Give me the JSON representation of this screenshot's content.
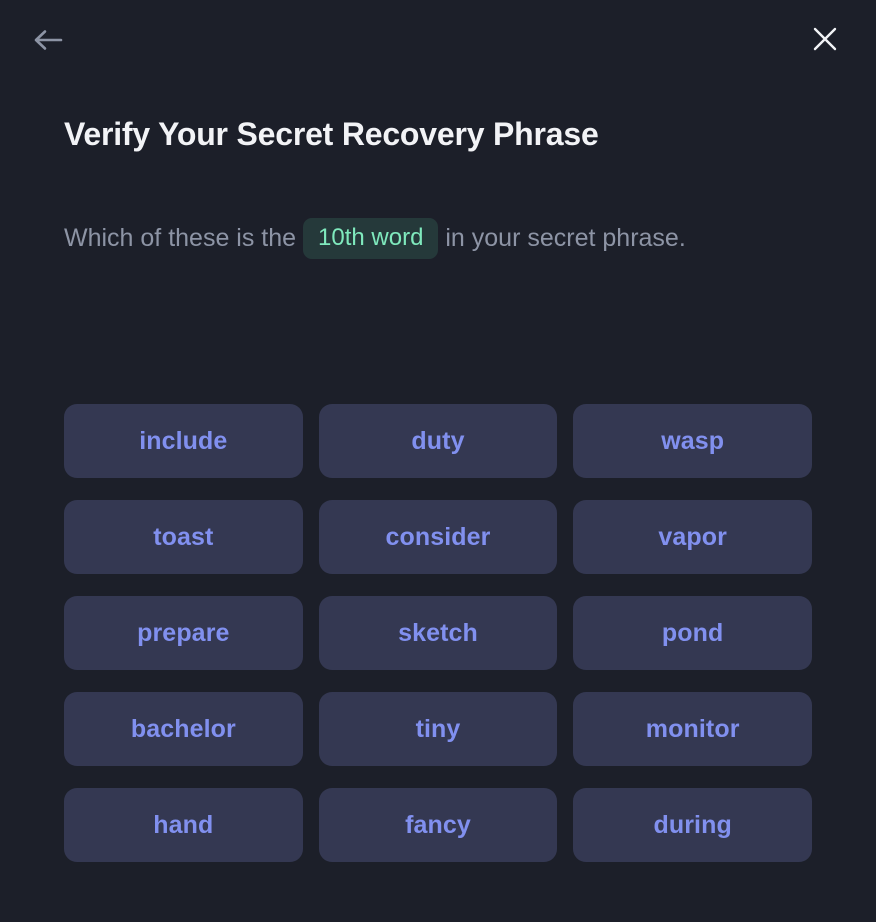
{
  "theme": {
    "background": "#1c1f29",
    "title_color": "#f2f3f6",
    "subtitle_color": "#8d94a5",
    "badge_background": "#25393a",
    "badge_text_color": "#7fe9bd",
    "option_background": "#343852",
    "option_text_color": "#8190ef",
    "back_icon_color": "#8d94a5",
    "close_icon_color": "#f2f3f6"
  },
  "topbar": {
    "back_icon": "arrow-left-icon",
    "back_label": "Back",
    "close_icon": "close-icon",
    "close_label": "Close"
  },
  "header": {
    "title": "Verify Your Secret Recovery Phrase"
  },
  "prompt": {
    "text_before": "Which of these is the",
    "badge": "10th word",
    "text_after": "in your secret phrase."
  },
  "options": [
    {
      "label": "include"
    },
    {
      "label": "duty"
    },
    {
      "label": "wasp"
    },
    {
      "label": "toast"
    },
    {
      "label": "consider"
    },
    {
      "label": "vapor"
    },
    {
      "label": "prepare"
    },
    {
      "label": "sketch"
    },
    {
      "label": "pond"
    },
    {
      "label": "bachelor"
    },
    {
      "label": "tiny"
    },
    {
      "label": "monitor"
    },
    {
      "label": "hand"
    },
    {
      "label": "fancy"
    },
    {
      "label": "during"
    }
  ]
}
